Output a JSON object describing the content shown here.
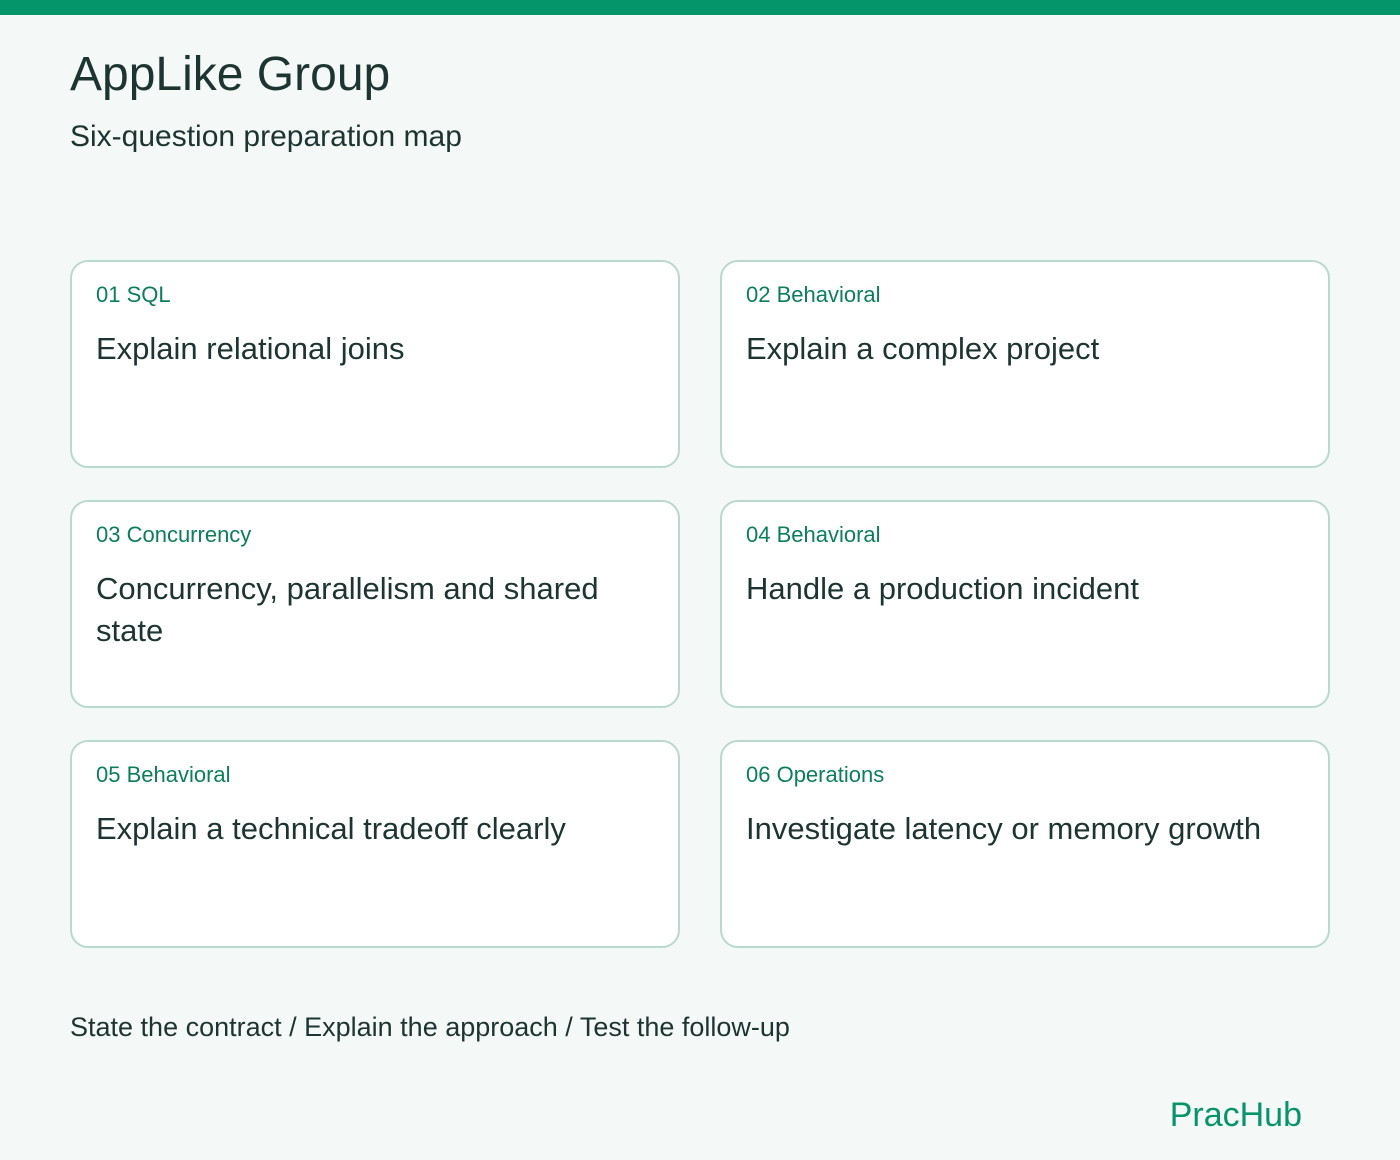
{
  "header": {
    "title": "AppLike Group",
    "subtitle": "Six-question preparation map"
  },
  "cards": [
    {
      "tag": "01 SQL",
      "title": "Explain relational joins"
    },
    {
      "tag": "02 Behavioral",
      "title": "Explain a complex project"
    },
    {
      "tag": "03 Concurrency",
      "title": "Concurrency, parallelism and shared state"
    },
    {
      "tag": "04 Behavioral",
      "title": "Handle a production incident"
    },
    {
      "tag": "05 Behavioral",
      "title": "Explain a technical tradeoff clearly"
    },
    {
      "tag": "06 Operations",
      "title": "Investigate latency or memory growth"
    }
  ],
  "footer": {
    "steps": "State the contract / Explain the approach / Test the follow-up",
    "brand": "PracHub"
  },
  "colors": {
    "accent": "#04956a",
    "tag_text": "#0b7e5b",
    "card_border": "#b9d9cf",
    "background": "#f4f8f6",
    "text": "#1d3531"
  }
}
